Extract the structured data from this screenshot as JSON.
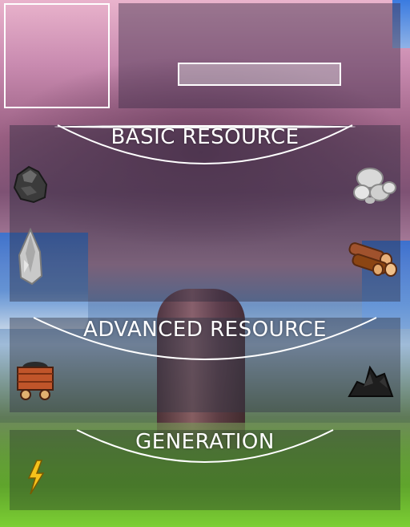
{
  "sections": {
    "basic": {
      "title": "BASIC RESOURCE"
    },
    "advanced": {
      "title": "ADVANCED RESOURCE"
    },
    "generation": {
      "title": "GENERATION"
    }
  },
  "icons": {
    "basic": [
      "coal-rock-icon",
      "stone-pile-icon",
      "flint-icon",
      "wood-logs-icon"
    ],
    "advanced": [
      "minecart-icon",
      "coal-pile-icon"
    ],
    "generation": [
      "lightning-icon"
    ]
  },
  "colors": {
    "panel": "#28283c",
    "outline": "#ffffff",
    "text": "#ffffff",
    "lightning": "#f6c21b"
  }
}
